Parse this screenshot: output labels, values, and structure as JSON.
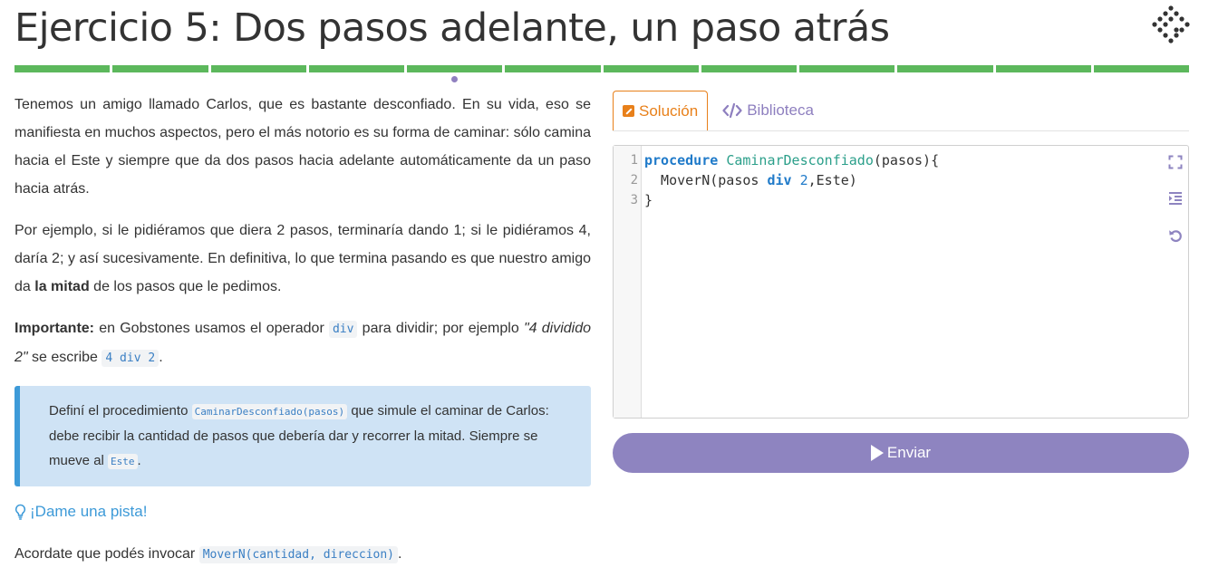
{
  "page": {
    "title": "Ejercicio 5: Dos pasos adelante, un paso atrás"
  },
  "progress": {
    "segments": 12,
    "current": 5
  },
  "statement": {
    "p1": "Tenemos un amigo llamado Carlos, que es bastante desconfiado. En su vida, eso se manifiesta en muchos aspectos, pero el más notorio es su forma de caminar: sólo camina hacia el Este y siempre que da dos pasos hacia adelante automáticamente da un paso hacia atrás.",
    "p2_a": "Por ejemplo, si le pidiéramos que diera 2 pasos, terminaría dando 1; si le pidiéramos 4, daría 2; y así sucesivamente. En definitiva, lo que termina pasando es que nuestro amigo da ",
    "p2_bold": "la mitad",
    "p2_b": " de los pasos que le pedimos.",
    "p3_bold": "Importante:",
    "p3_a": " en Gobstones usamos el operador ",
    "p3_code1": "div",
    "p3_b": " para dividir; por ejemplo ",
    "p3_italic": "\"4 dividido 2\"",
    "p3_c": " se escribe ",
    "p3_code2": "4 div 2",
    "p3_d": "."
  },
  "callout": {
    "a": "Definí el procedimiento ",
    "code1": "CaminarDesconfiado(pasos)",
    "b": " que simule el caminar de Carlos: debe recibir la cantidad de pasos que debería dar y recorrer la mitad. Siempre se mueve al ",
    "code2": "Este",
    "c": "."
  },
  "hint": {
    "label": "¡Dame una pista!",
    "icon": "lightbulb-icon"
  },
  "note": {
    "a": "Acordate que podés invocar ",
    "code": "MoverN(cantidad, direccion)",
    "b": "."
  },
  "tabs": {
    "solution": "Solución",
    "library": "Biblioteca"
  },
  "editor": {
    "line_numbers": [
      "1",
      "2",
      "3"
    ],
    "l1_kw": "procedure",
    "l1_fn": "CaminarDesconfiado",
    "l1_rest": "(pasos){",
    "l2_a": "  MoverN(pasos ",
    "l2_kw": "div",
    "l2_num": "2",
    "l2_b": ",Este)",
    "l3": "}"
  },
  "send": {
    "label": "Enviar"
  },
  "colors": {
    "progress": "#5cb85c",
    "accent_orange": "#e8801a",
    "accent_purple": "#8e84c0",
    "callout_bg": "#cfe3f5",
    "callout_border": "#3d9ad8"
  }
}
